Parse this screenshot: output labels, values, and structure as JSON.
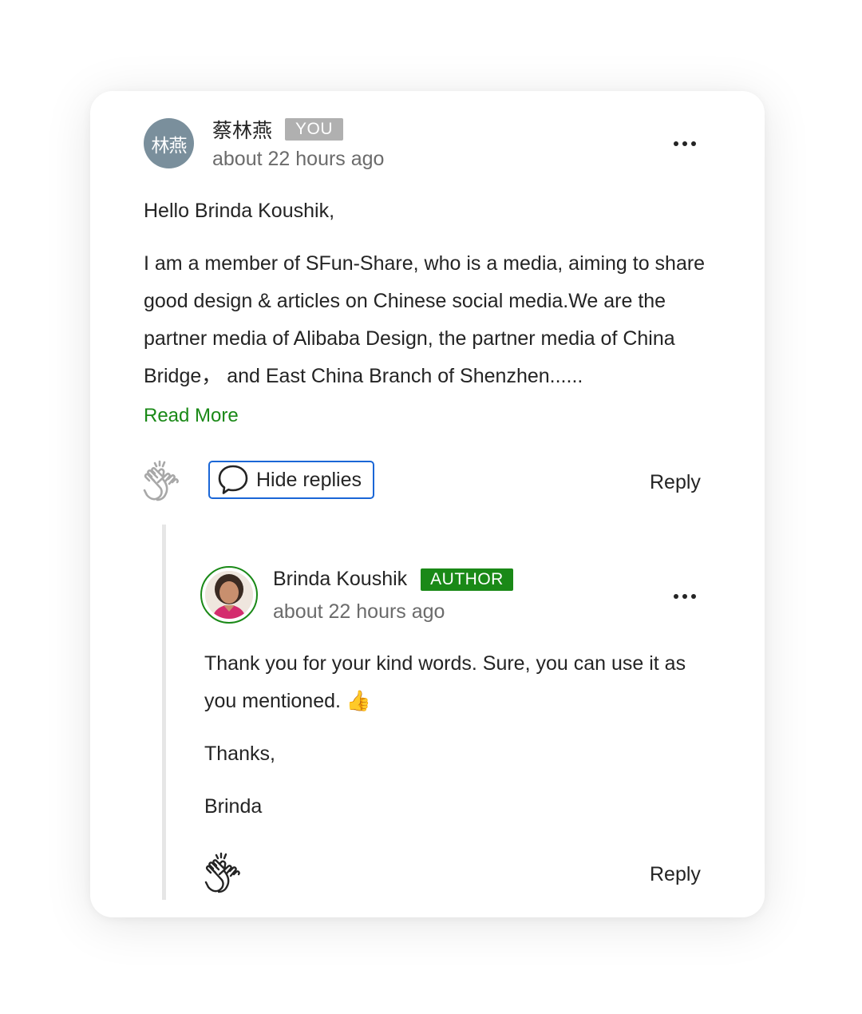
{
  "comment": {
    "avatar_initials": "林燕",
    "author": "蔡林燕",
    "badge": "YOU",
    "time": "about 22 hours ago",
    "greeting": "Hello Brinda Koushik,",
    "body": "I am a member of SFun-Share, who is a media, aiming to share good design & articles on Chinese social media.We are the partner media of Alibaba Design, the partner media of China Bridge，  and East China Branch of Shenzhen......",
    "read_more": "Read More",
    "hide_replies": "Hide replies",
    "reply": "Reply"
  },
  "reply_comment": {
    "author": "Brinda Koushik",
    "badge": "AUTHOR",
    "time": "about 22 hours ago",
    "paragraphs": [
      "Thank you for your kind words. Sure, you can use it as you mentioned. 👍",
      "Thanks,",
      "Brinda"
    ],
    "reply": "Reply"
  },
  "colors": {
    "accent_green": "#1a8917",
    "focus_blue": "#1a66d6",
    "you_badge": "#b0b0b0"
  },
  "icons": [
    "clap-icon",
    "comment-bubble-icon",
    "more-options-icon"
  ]
}
